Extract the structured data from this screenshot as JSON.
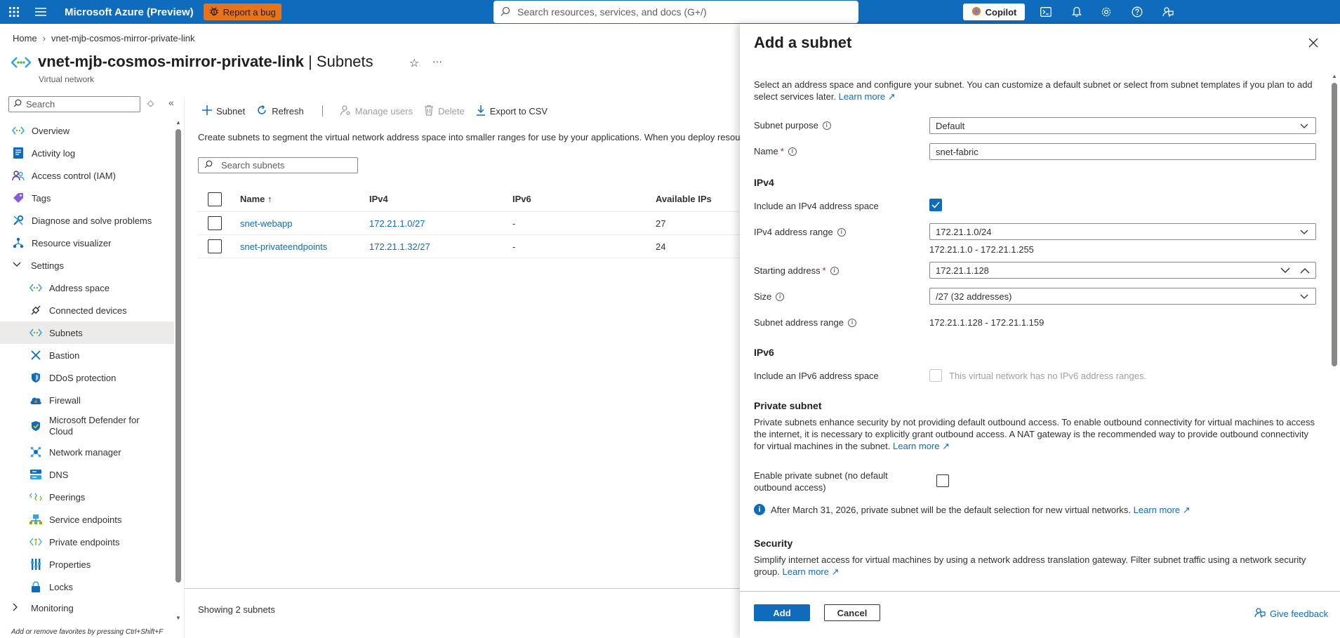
{
  "topbar": {
    "brand": "Microsoft Azure (Preview)",
    "bug_label": "Report a bug",
    "search_placeholder": "Search resources, services, and docs (G+/)",
    "copilot_label": "Copilot"
  },
  "breadcrumb": {
    "home": "Home",
    "current": "vnet-mjb-cosmos-mirror-private-link"
  },
  "resource": {
    "name": "vnet-mjb-cosmos-mirror-private-link",
    "section": "| Subnets",
    "type": "Virtual network"
  },
  "left_search_placeholder": "Search",
  "nav": {
    "overview": "Overview",
    "activity_log": "Activity log",
    "iam": "Access control (IAM)",
    "tags": "Tags",
    "diagnose": "Diagnose and solve problems",
    "visualizer": "Resource visualizer",
    "settings": "Settings",
    "address_space": "Address space",
    "connected_devices": "Connected devices",
    "subnets": "Subnets",
    "bastion": "Bastion",
    "ddos": "DDoS protection",
    "firewall": "Firewall",
    "defender_line1": "Microsoft Defender for",
    "defender_line2": "Cloud",
    "network_manager": "Network manager",
    "dns": "DNS",
    "peerings": "Peerings",
    "service_endpoints": "Service endpoints",
    "private_endpoints": "Private endpoints",
    "properties": "Properties",
    "locks": "Locks",
    "monitoring": "Monitoring"
  },
  "left_footer": "Add or remove favorites by pressing Ctrl+Shift+F",
  "toolbar": {
    "subnet": "Subnet",
    "refresh": "Refresh",
    "manage_users": "Manage users",
    "delete": "Delete",
    "export": "Export to CSV"
  },
  "main_description": "Create subnets to segment the virtual network address space into smaller ranges for use by your applications. When you deploy resources into a subnet, Azure assigns the resource an IP address from the subnet.",
  "subnet_search_placeholder": "Search subnets",
  "table": {
    "headers": {
      "name": "Name ↑",
      "ipv4": "IPv4",
      "ipv6": "IPv6",
      "available_ips": "Available IPs"
    },
    "rows": [
      {
        "name": "snet-webapp",
        "ipv4": "172.21.1.0/27",
        "ipv6": "-",
        "available_ips": "27"
      },
      {
        "name": "snet-privateendpoints",
        "ipv4": "172.21.1.32/27",
        "ipv6": "-",
        "available_ips": "24"
      }
    ]
  },
  "showing": "Showing 2 subnets",
  "panel": {
    "title": "Add a subnet",
    "intro_line1": "Select an address space and configure your subnet. You can customize a default subnet or select from subnet templates if you plan to add",
    "intro_line2": "select services later.",
    "learn_more": "Learn more",
    "subnet_purpose_label": "Subnet purpose",
    "subnet_purpose_value": "Default",
    "name_label": "Name",
    "name_value": "snet-fabric",
    "ipv4_heading": "IPv4",
    "include_ipv4_label": "Include an IPv4 address space",
    "ipv4_range_label": "IPv4 address range",
    "ipv4_range_value": "172.21.1.0/24",
    "ipv4_range_hint": "172.21.1.0 - 172.21.1.255",
    "starting_label": "Starting address",
    "starting_value": "172.21.1.128",
    "size_label": "Size",
    "size_value": "/27 (32 addresses)",
    "subnet_range_label": "Subnet address range",
    "subnet_range_value": "172.21.1.128 - 172.21.1.159",
    "ipv6_heading": "IPv6",
    "include_ipv6_label": "Include an IPv6 address space",
    "ipv6_disabled_text": "This virtual network has no IPv6 address ranges.",
    "private_heading": "Private subnet",
    "private_line1": "Private subnets enhance security by not providing default outbound access. To enable outbound connectivity for virtual machines to access",
    "private_line2": "the internet, it is necessary to explicitly grant outbound access. A NAT gateway is the recommended way to provide outbound connectivity",
    "private_line3": "for virtual machines in the subnet.",
    "enable_private_line1": "Enable private subnet (no default",
    "enable_private_line2": "outbound access)",
    "notice": "After March 31, 2026, private subnet will be the default selection for new virtual networks.",
    "security_heading": "Security",
    "security_line1": "Simplify internet access for virtual machines by using a network address translation gateway. Filter subnet traffic using a network security",
    "security_line2": "group.",
    "add_label": "Add",
    "cancel_label": "Cancel",
    "feedback_label": "Give feedback"
  }
}
